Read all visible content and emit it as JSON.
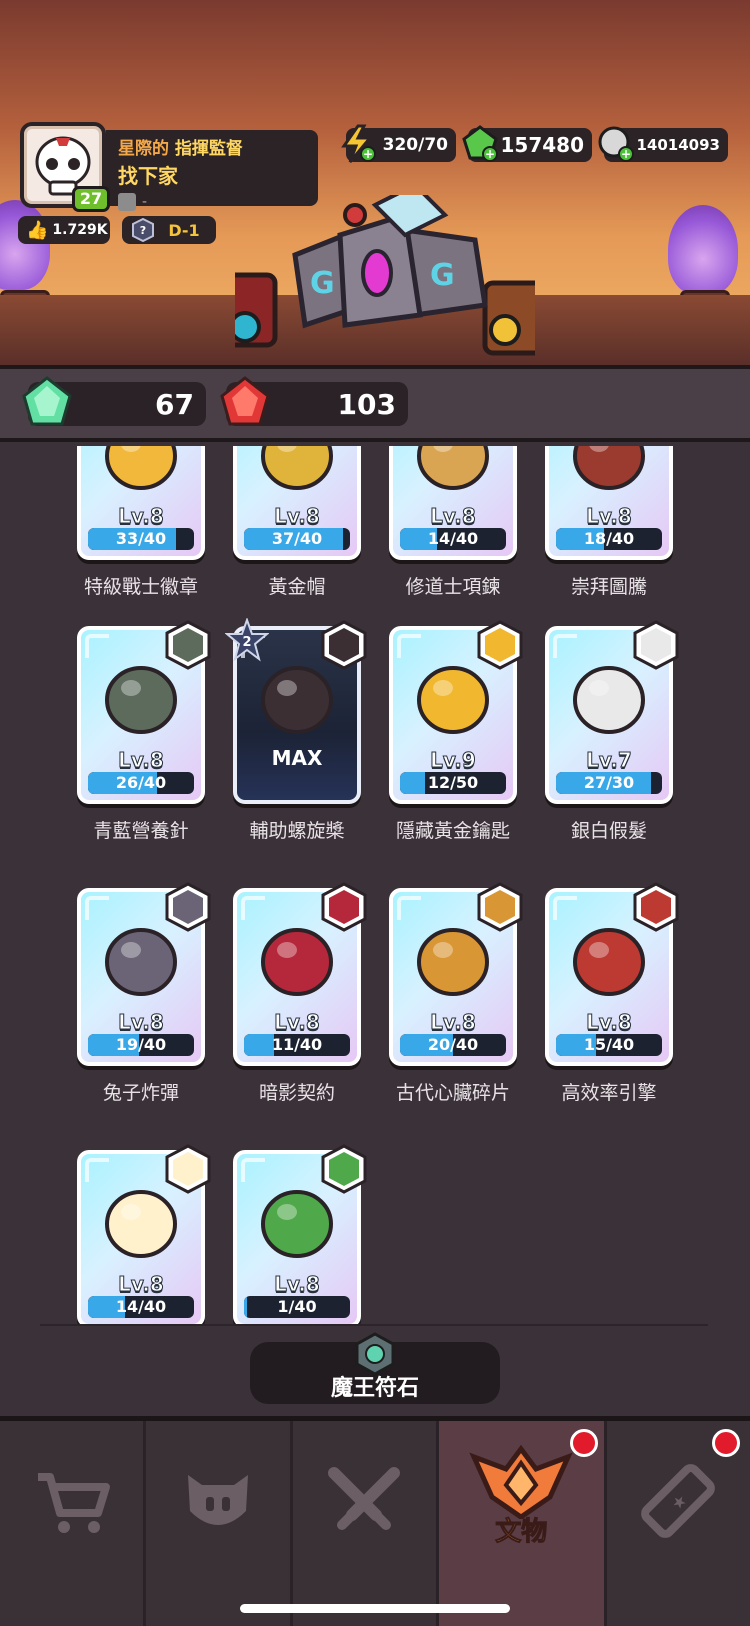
{
  "profile": {
    "title_prefix": "星際的",
    "title_suffix": "指揮監督",
    "name": "找下家",
    "guild": "-",
    "level": "27",
    "likes": "1.729K",
    "rank": "D-1"
  },
  "resources": {
    "energy": "320/70",
    "gems": "157480",
    "coins": "14014093"
  },
  "gem_counts": {
    "green": "67",
    "red": "103"
  },
  "artifacts": [
    {
      "name": "特級戰士徽章",
      "level": "Lv.8",
      "progress": "33/40",
      "fill": 0.825
    },
    {
      "name": "黃金帽",
      "level": "Lv.8",
      "progress": "37/40",
      "fill": 0.925
    },
    {
      "name": "修道士項鍊",
      "level": "Lv.8",
      "progress": "14/40",
      "fill": 0.35
    },
    {
      "name": "崇拜圖騰",
      "level": "Lv.8",
      "progress": "18/40",
      "fill": 0.45
    },
    {
      "name": "青藍營養針",
      "level": "Lv.8",
      "progress": "26/40",
      "fill": 0.65
    },
    {
      "name": "輔助螺旋槳",
      "level": "MAX",
      "progress": "",
      "fill": 1,
      "stars": "2"
    },
    {
      "name": "隱藏黃金鑰匙",
      "level": "Lv.9",
      "progress": "12/50",
      "fill": 0.24
    },
    {
      "name": "銀白假髮",
      "level": "Lv.7",
      "progress": "27/30",
      "fill": 0.9
    },
    {
      "name": "兔子炸彈",
      "level": "Lv.8",
      "progress": "19/40",
      "fill": 0.475
    },
    {
      "name": "暗影契約",
      "level": "Lv.8",
      "progress": "11/40",
      "fill": 0.275
    },
    {
      "name": "古代心臟碎片",
      "level": "Lv.8",
      "progress": "20/40",
      "fill": 0.5
    },
    {
      "name": "高效率引擎",
      "level": "Lv.8",
      "progress": "15/40",
      "fill": 0.375
    },
    {
      "name": "",
      "level": "Lv.8",
      "progress": "14/40",
      "fill": 0.35
    },
    {
      "name": "",
      "level": "Lv.8",
      "progress": "1/40",
      "fill": 0.025
    }
  ],
  "rune_button": "魔王符石",
  "nav": {
    "items": [
      "shop",
      "pet",
      "battle",
      "文物",
      "ticket"
    ],
    "active_label": "文物"
  },
  "colors": {
    "accent": "#f39c4c",
    "progress": "#39a8e8",
    "badge_red": "#e21b2c"
  }
}
